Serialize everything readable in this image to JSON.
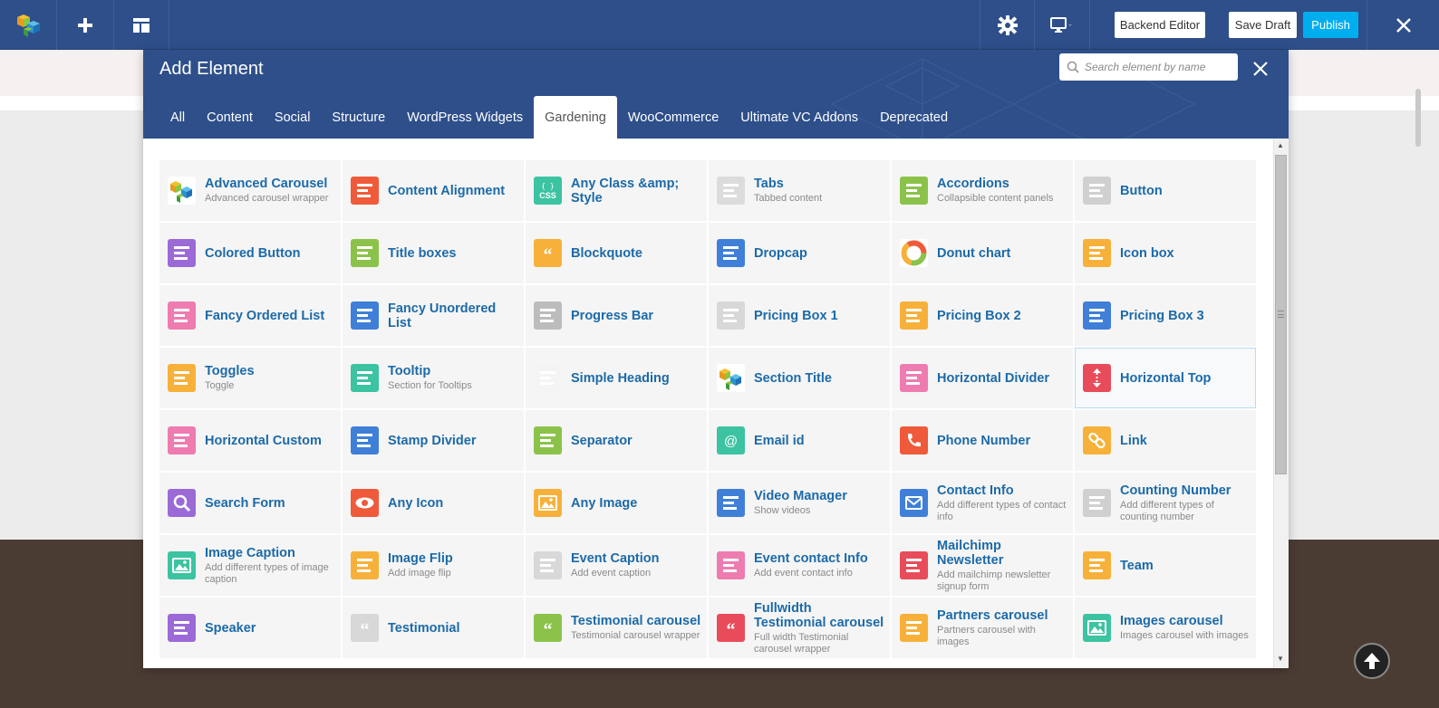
{
  "topbar": {
    "backend_editor_label": "Backend Editor",
    "save_draft_label": "Save Draft",
    "publish_label": "Publish"
  },
  "modal": {
    "title": "Add Element",
    "search_placeholder": "Search element by name",
    "tabs": [
      {
        "label": "All",
        "active": false
      },
      {
        "label": "Content",
        "active": false
      },
      {
        "label": "Social",
        "active": false
      },
      {
        "label": "Structure",
        "active": false
      },
      {
        "label": "WordPress Widgets",
        "active": false
      },
      {
        "label": "Gardening",
        "active": true
      },
      {
        "label": "WooCommerce",
        "active": false
      },
      {
        "label": "Ultimate VC Addons",
        "active": false
      },
      {
        "label": "Deprecated",
        "active": false
      }
    ]
  },
  "colors": {
    "header_blue": "#2e4f8a",
    "publish_blue": "#00aeef",
    "link_blue": "#1c6aa8"
  },
  "elements": [
    {
      "name": "Advanced Carousel",
      "desc": "Advanced carousel wrapper",
      "icon": "vc-cubes-icon",
      "color": "#ffffff"
    },
    {
      "name": "Content Alignment",
      "desc": "",
      "icon": "text-align-icon",
      "color": "#ef5a3a"
    },
    {
      "name": "Any Class &amp; Style",
      "desc": "",
      "icon": "css-icon",
      "color": "#3cc3a1"
    },
    {
      "name": "Tabs",
      "desc": "Tabbed content",
      "icon": "tabs-icon",
      "color": "#dcdcdc"
    },
    {
      "name": "Accordions",
      "desc": "Collapsible content panels",
      "icon": "accordion-icon",
      "color": "#8bc34a"
    },
    {
      "name": "Button",
      "desc": "",
      "icon": "hand-button-icon",
      "color": "#d0d0d0"
    },
    {
      "name": "Colored Button",
      "desc": "",
      "icon": "hand-pointer-icon",
      "color": "#9b6ad6"
    },
    {
      "name": "Title boxes",
      "desc": "",
      "icon": "title-box-icon",
      "color": "#8bc34a"
    },
    {
      "name": "Blockquote",
      "desc": "",
      "icon": "quote-bubble-icon",
      "color": "#f7b13a"
    },
    {
      "name": "Dropcap",
      "desc": "",
      "icon": "dropcap-icon",
      "color": "#3f7fd8"
    },
    {
      "name": "Donut chart",
      "desc": "",
      "icon": "donut-chart-icon",
      "color": "#ffffff"
    },
    {
      "name": "Icon box",
      "desc": "",
      "icon": "gears-icon",
      "color": "#f7b13a"
    },
    {
      "name": "Fancy Ordered List",
      "desc": "",
      "icon": "ordered-list-icon",
      "color": "#ee7cb0"
    },
    {
      "name": "Fancy Unordered List",
      "desc": "",
      "icon": "unordered-list-icon",
      "color": "#3f7fd8"
    },
    {
      "name": "Progress Bar",
      "desc": "",
      "icon": "progress-bars-icon",
      "color": "#bcbcbc"
    },
    {
      "name": "Pricing Box 1",
      "desc": "",
      "icon": "price-tag-icon",
      "color": "#d8d8d8"
    },
    {
      "name": "Pricing Box 2",
      "desc": "",
      "icon": "price-ten-icon",
      "color": "#f7b13a"
    },
    {
      "name": "Pricing Box 3",
      "desc": "",
      "icon": "price-circle-icon",
      "color": "#3f7fd8"
    },
    {
      "name": "Toggles",
      "desc": "Toggle",
      "icon": "toggle-list-icon",
      "color": "#f7b13a"
    },
    {
      "name": "Tooltip",
      "desc": "Section for Tooltips",
      "icon": "tooltip-icon",
      "color": "#3cc3a1"
    },
    {
      "name": "Simple Heading",
      "desc": "",
      "icon": "heading-icon",
      "color": "#f4f4f4"
    },
    {
      "name": "Section Title",
      "desc": "",
      "icon": "vc-cubes-icon",
      "color": "#ffffff"
    },
    {
      "name": "Horizontal Divider",
      "desc": "",
      "icon": "divider-icon",
      "color": "#ee7cb0"
    },
    {
      "name": "Horizontal Top",
      "desc": "",
      "icon": "vertical-arrows-icon",
      "color": "#e84c5a"
    },
    {
      "name": "Horizontal Custom",
      "desc": "",
      "icon": "dashed-divider-icon",
      "color": "#ee7cb0"
    },
    {
      "name": "Stamp Divider",
      "desc": "",
      "icon": "stamp-icon",
      "color": "#3f7fd8"
    },
    {
      "name": "Separator",
      "desc": "",
      "icon": "separator-icon",
      "color": "#8bc34a"
    },
    {
      "name": "Email id",
      "desc": "",
      "icon": "at-icon",
      "color": "#3cc3a1"
    },
    {
      "name": "Phone Number",
      "desc": "",
      "icon": "phone-icon",
      "color": "#ef5a3a"
    },
    {
      "name": "Link",
      "desc": "",
      "icon": "link-icon",
      "color": "#f7b13a"
    },
    {
      "name": "Search Form",
      "desc": "",
      "icon": "search-icon",
      "color": "#9b6ad6"
    },
    {
      "name": "Any Icon",
      "desc": "",
      "icon": "eye-icon",
      "color": "#ef5a3a"
    },
    {
      "name": "Any Image",
      "desc": "",
      "icon": "image-icon",
      "color": "#f7b13a"
    },
    {
      "name": "Video Manager",
      "desc": "Show videos",
      "icon": "video-camera-icon",
      "color": "#3f7fd8"
    },
    {
      "name": "Contact Info",
      "desc": "Add different types of contact info",
      "icon": "envelope-icon",
      "color": "#3f7fd8"
    },
    {
      "name": "Counting Number",
      "desc": "Add different types of counting number",
      "icon": "counter-icon",
      "color": "#d0d0d0"
    },
    {
      "name": "Image Caption",
      "desc": "Add different types of image caption",
      "icon": "image-caption-icon",
      "color": "#3cc3a1"
    },
    {
      "name": "Image Flip",
      "desc": "Add image flip",
      "icon": "image-flip-icon",
      "color": "#f7b13a"
    },
    {
      "name": "Event Caption",
      "desc": "Add event caption",
      "icon": "chat-bubble-icon",
      "color": "#d8d8d8"
    },
    {
      "name": "Event contact Info",
      "desc": "Add event contact info",
      "icon": "contact-card-icon",
      "color": "#ee7cb0"
    },
    {
      "name": "Mailchimp Newsletter",
      "desc": "Add mailchimp newsletter signup form",
      "icon": "mailchimp-icon",
      "color": "#e84c5a"
    },
    {
      "name": "Team",
      "desc": "",
      "icon": "team-icon",
      "color": "#f7b13a"
    },
    {
      "name": "Speaker",
      "desc": "",
      "icon": "megaphone-icon",
      "color": "#9b6ad6"
    },
    {
      "name": "Testimonial",
      "desc": "",
      "icon": "quote-icon",
      "color": "#d8d8d8"
    },
    {
      "name": "Testimonial carousel",
      "desc": "Testimonial carousel wrapper",
      "icon": "quote-carousel-icon",
      "color": "#8bc34a"
    },
    {
      "name": "Fullwidth Testimonial carousel",
      "desc": "Full width Testimonial carousel wrapper",
      "icon": "fullwidth-quote-icon",
      "color": "#e84c5a"
    },
    {
      "name": "Partners carousel",
      "desc": "Partners carousel with images",
      "icon": "handshake-icon",
      "color": "#f7b13a"
    },
    {
      "name": "Images carousel",
      "desc": "Images carousel with images",
      "icon": "images-carousel-icon",
      "color": "#3cc3a1"
    }
  ],
  "highlighted_element": "Horizontal Top"
}
